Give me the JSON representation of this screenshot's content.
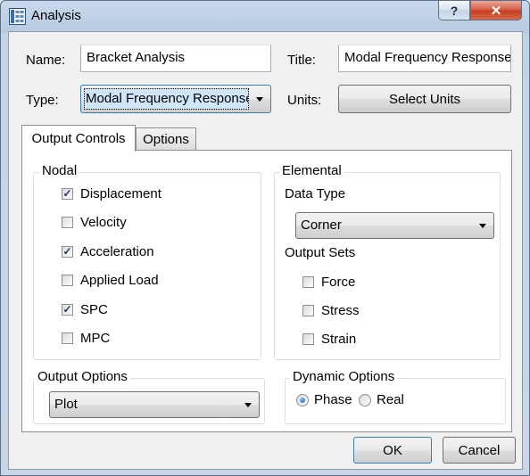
{
  "window": {
    "title": "Analysis",
    "help_glyph": "?",
    "close_glyph": "✕"
  },
  "form": {
    "name_label": "Name:",
    "name_value": "Bracket Analysis",
    "title_label": "Title:",
    "title_value": "Modal Frequency Response",
    "type_label": "Type:",
    "type_value": "Modal Frequency Response",
    "units_label": "Units:",
    "select_units_label": "Select Units"
  },
  "tabs": [
    {
      "label": "Output Controls",
      "active": true
    },
    {
      "label": "Options",
      "active": false
    }
  ],
  "nodal": {
    "legend": "Nodal",
    "items": [
      {
        "label": "Displacement",
        "checked": true
      },
      {
        "label": "Velocity",
        "checked": false
      },
      {
        "label": "Acceleration",
        "checked": true
      },
      {
        "label": "Applied Load",
        "checked": false
      },
      {
        "label": "SPC",
        "checked": true
      },
      {
        "label": "MPC",
        "checked": false
      }
    ]
  },
  "elemental": {
    "legend": "Elemental",
    "data_type_label": "Data Type",
    "data_type_value": "Corner",
    "output_sets_label": "Output Sets",
    "items": [
      {
        "label": "Force",
        "checked": false
      },
      {
        "label": "Stress",
        "checked": false
      },
      {
        "label": "Strain",
        "checked": false
      }
    ]
  },
  "output_options": {
    "legend": "Output Options",
    "value": "Plot"
  },
  "dynamic_options": {
    "legend": "Dynamic Options",
    "options": [
      {
        "label": "Phase",
        "selected": true
      },
      {
        "label": "Real",
        "selected": false
      }
    ]
  },
  "buttons": {
    "ok": "OK",
    "cancel": "Cancel"
  },
  "check_glyph": "✓"
}
